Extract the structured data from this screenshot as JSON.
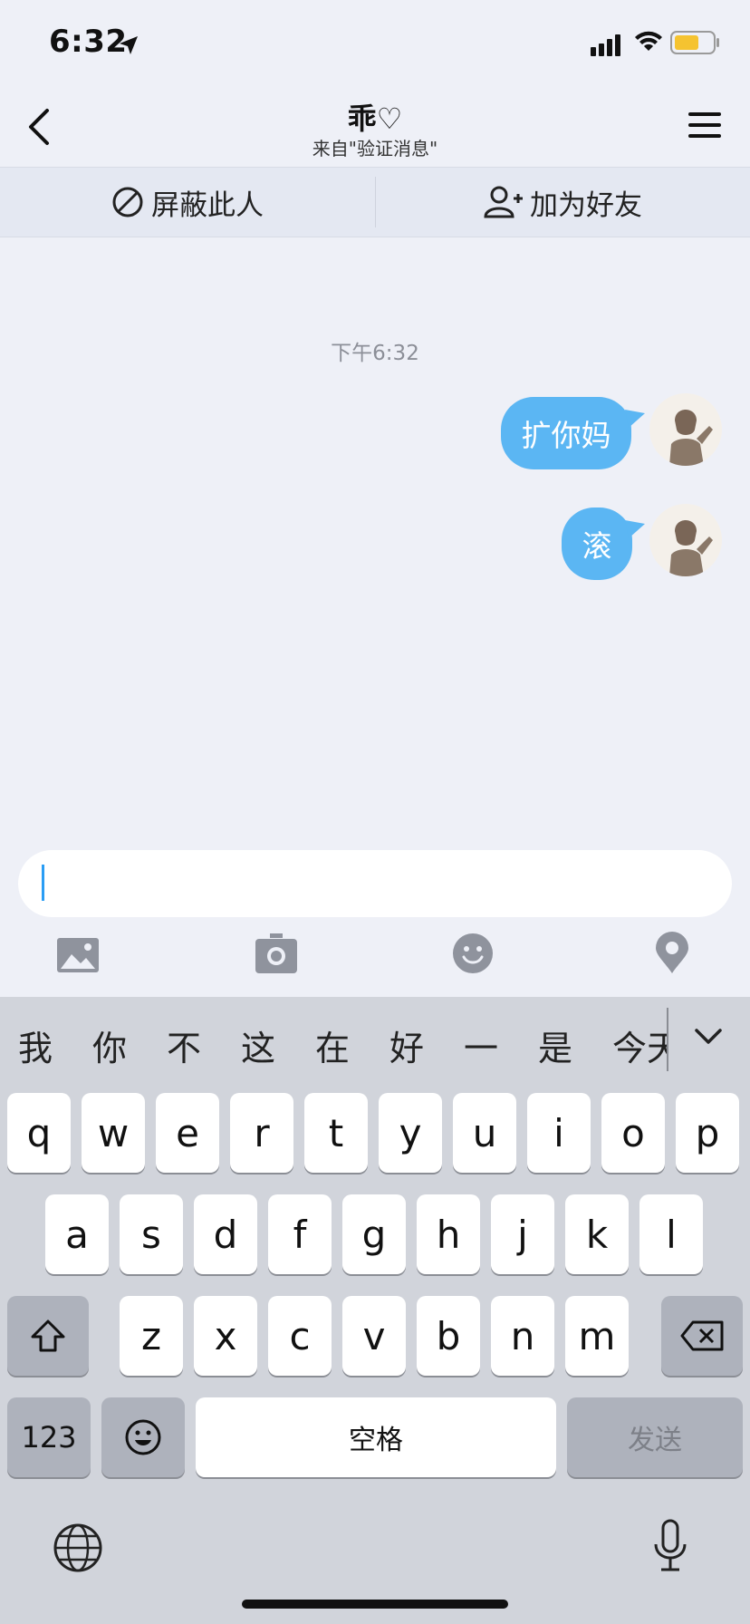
{
  "status_bar": {
    "time": "6:32"
  },
  "header": {
    "title": "乖♡",
    "subtitle": "来自\"验证消息\""
  },
  "actions": {
    "block_label": "屏蔽此人",
    "add_friend_label": "加为好友"
  },
  "chat": {
    "timestamp": "下午6:32",
    "messages": [
      {
        "text": "扩你妈",
        "sender": "me"
      },
      {
        "text": "滚",
        "sender": "me"
      }
    ]
  },
  "toolbar_icons": [
    "image-icon",
    "camera-icon",
    "emoji-icon",
    "location-icon"
  ],
  "keyboard": {
    "candidates": [
      "我",
      "你",
      "不",
      "这",
      "在",
      "好",
      "一",
      "是",
      "今天"
    ],
    "row1": [
      "q",
      "w",
      "e",
      "r",
      "t",
      "y",
      "u",
      "i",
      "o",
      "p"
    ],
    "row2": [
      "a",
      "s",
      "d",
      "f",
      "g",
      "h",
      "j",
      "k",
      "l"
    ],
    "row3": [
      "z",
      "x",
      "c",
      "v",
      "b",
      "n",
      "m"
    ],
    "num_label": "123",
    "space_label": "空格",
    "send_label": "发送"
  },
  "colors": {
    "bubble": "#5bb6f3",
    "background": "#eef0f7",
    "keyboard": "#d1d4db"
  }
}
